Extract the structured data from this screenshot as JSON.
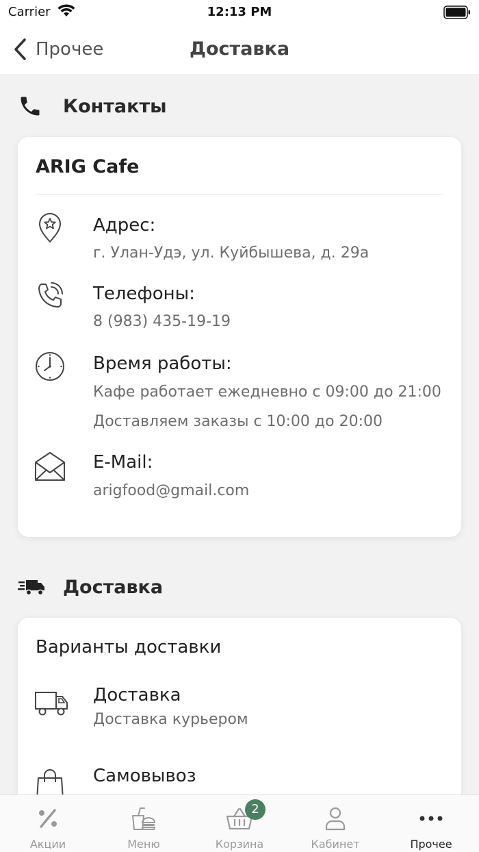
{
  "status_bar": {
    "carrier": "Carrier",
    "time": "12:13 PM"
  },
  "nav": {
    "back_label": "Прочее",
    "title": "Доставка"
  },
  "contacts": {
    "section_title": "Контакты",
    "card_title": "ARIG Cafe",
    "address": {
      "label": "Адрес:",
      "value": "г. Улан-Удэ, ул. Куйбышева, д. 29а"
    },
    "phones": {
      "label": "Телефоны:",
      "value": "8 (983) 435-19-19"
    },
    "hours": {
      "label": "Время работы:",
      "line1": "Кафе работает ежедневно с 09:00 до 21:00",
      "line2": "Доставляем заказы с 10:00 до 20:00"
    },
    "email": {
      "label": "E-Mail:",
      "value": "arigfood@gmail.com"
    }
  },
  "delivery": {
    "section_title": "Доставка",
    "options_title": "Варианты доставки",
    "options": [
      {
        "title": "Доставка",
        "subtitle": "Доставка курьером",
        "icon": "truck-icon"
      },
      {
        "title": "Самовывоз",
        "icon": "shopping-bag-icon"
      }
    ]
  },
  "tabbar": {
    "tabs": [
      {
        "label": "Акции",
        "icon": "percent-icon"
      },
      {
        "label": "Меню",
        "icon": "food-icon"
      },
      {
        "label": "Корзина",
        "icon": "basket-icon",
        "badge": "2"
      },
      {
        "label": "Кабинет",
        "icon": "user-icon"
      },
      {
        "label": "Прочее",
        "icon": "more-dots-icon"
      }
    ],
    "active_index": 4,
    "badge_color": "#4a7f62"
  }
}
